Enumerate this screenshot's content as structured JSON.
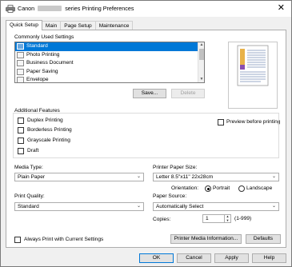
{
  "titlebar": {
    "title_prefix": "Canon",
    "title_suffix": "series Printing Preferences",
    "close_glyph": "✕"
  },
  "tabs": [
    {
      "label": "Quick Setup",
      "active": true
    },
    {
      "label": "Main",
      "active": false
    },
    {
      "label": "Page Setup",
      "active": false
    },
    {
      "label": "Maintenance",
      "active": false
    }
  ],
  "common": {
    "heading": "Commonly Used Settings",
    "items": [
      "Standard",
      "Photo Printing",
      "Business Document",
      "Paper Saving",
      "Envelope"
    ],
    "selected": "Standard",
    "save_label": "Save...",
    "delete_label": "Delete"
  },
  "preview": {
    "checkbox_label": "Preview before printing",
    "checked": false
  },
  "features": {
    "heading": "Additional Features",
    "items": [
      {
        "label": "Duplex Printing",
        "checked": false
      },
      {
        "label": "Borderless Printing",
        "checked": false
      },
      {
        "label": "Grayscale Printing",
        "checked": false
      },
      {
        "label": "Draft",
        "checked": false
      }
    ]
  },
  "media_type": {
    "label": "Media Type:",
    "value": "Plain Paper"
  },
  "paper_size": {
    "label": "Printer Paper Size:",
    "value": "Letter 8.5\"x11\" 22x28cm"
  },
  "orientation": {
    "label": "Orientation:",
    "options": [
      "Portrait",
      "Landscape"
    ],
    "selected": "Portrait"
  },
  "print_quality": {
    "label": "Print Quality:",
    "value": "Standard"
  },
  "paper_source": {
    "label": "Paper Source:",
    "value": "Automatically Select"
  },
  "copies": {
    "label": "Copies:",
    "value": "1",
    "range": "(1-999)"
  },
  "always_print": {
    "label": "Always Print with Current Settings",
    "checked": false
  },
  "buttons": {
    "media_info": "Printer Media Information...",
    "defaults": "Defaults",
    "ok": "OK",
    "cancel": "Cancel",
    "apply": "Apply",
    "help": "Help"
  },
  "icons": {
    "app": "printer-icon",
    "close": "close-icon",
    "dropdown": "chevron-down-icon"
  }
}
